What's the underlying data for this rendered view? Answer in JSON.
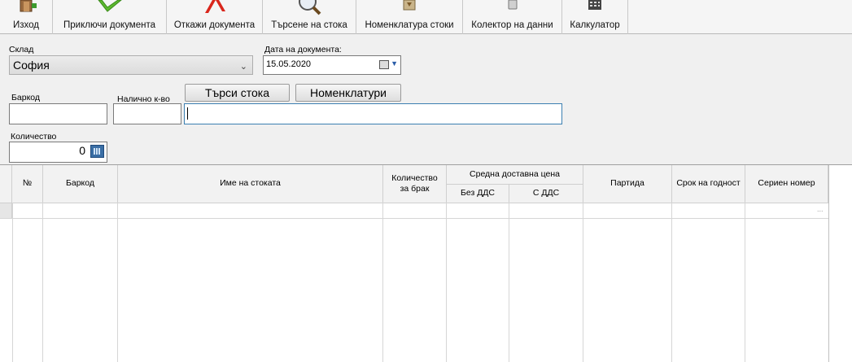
{
  "toolbar": {
    "items": [
      {
        "label": "Изход",
        "icon": "exit-icon"
      },
      {
        "label": "Приключи документа",
        "icon": "checkmark-icon"
      },
      {
        "label": "Откажи документа",
        "icon": "cancel-x-icon"
      },
      {
        "label": "Търсене на стока",
        "icon": "magnifier-icon"
      },
      {
        "label": "Номенклатура стоки",
        "icon": "catalog-icon"
      },
      {
        "label": "Колектор на данни",
        "icon": "barcode-scanner-icon"
      },
      {
        "label": "Калкулатор",
        "icon": "calculator-icon"
      }
    ]
  },
  "form": {
    "warehouse_label": "Склад",
    "warehouse_value": "София",
    "date_label": "Дата на документа:",
    "date_value": "15.05.2020",
    "barcode_label": "Баркод",
    "available_qty_label": "Налично к-во",
    "search_button": "Търси стока",
    "nomenclatures_button": "Номенклатури",
    "quantity_label": "Количество",
    "quantity_value": "0"
  },
  "grid": {
    "columns": {
      "no": "№",
      "barcode": "Баркод",
      "name": "Име на стоката",
      "qty_scrap": "Количество за брак",
      "avg_price": "Средна доставна цена",
      "no_vat": "Без ДДС",
      "with_vat": "С ДДС",
      "batch": "Партида",
      "expiry": "Срок на годност",
      "serial": "Сериен номер"
    },
    "new_row_marker": "..."
  },
  "colors": {
    "check_green": "#5cb82e",
    "cancel_red": "#d9261c",
    "focus_border": "#3c7fb1",
    "panel_bg": "#f0f0f0"
  }
}
